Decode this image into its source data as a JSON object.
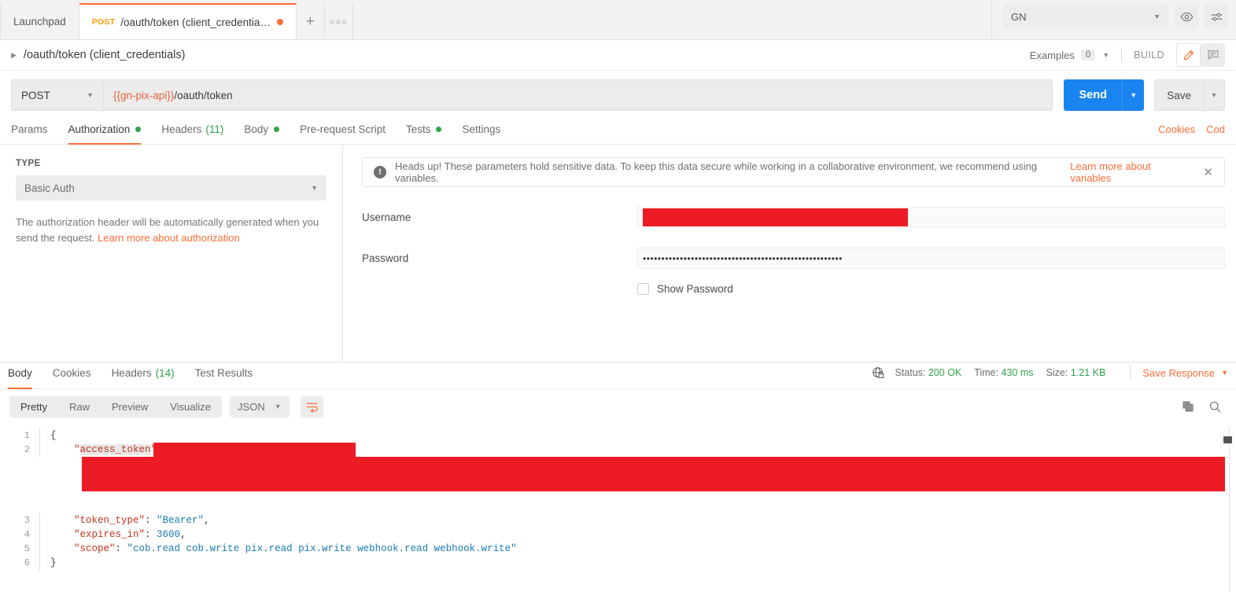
{
  "tabbar": {
    "tabs": [
      {
        "label": "Launchpad",
        "method": "",
        "active": false,
        "unsaved": false
      },
      {
        "label": "/oauth/token (client_credentia…",
        "method": "POST",
        "active": true,
        "unsaved": true
      }
    ],
    "add_tab": "+",
    "more_tabs": "○○○",
    "environment": "GN",
    "caret": "▼",
    "eye_icon": "eye-icon",
    "settings_icon": "sliders-icon"
  },
  "breadcrumb": {
    "expand_arrow": "▶",
    "title": "/oauth/token (client_credentials)",
    "examples_label": "Examples",
    "examples_count": "0",
    "examples_caret": "▼",
    "build_label": "BUILD",
    "edit_icon": "pencil-icon",
    "comment_icon": "comment-icon"
  },
  "url_row": {
    "method": "POST",
    "method_caret": "▼",
    "url_variable": "{{gn-pix-api}}",
    "url_path": "/oauth/token",
    "send_label": "Send",
    "send_caret": "▼",
    "save_label": "Save",
    "save_caret": "▼"
  },
  "request_tabs": {
    "items": [
      {
        "label": "Params",
        "active": false,
        "dot": false,
        "count": ""
      },
      {
        "label": "Authorization",
        "active": true,
        "dot": true,
        "count": ""
      },
      {
        "label": "Headers",
        "active": false,
        "dot": false,
        "count": "(11)"
      },
      {
        "label": "Body",
        "active": false,
        "dot": true,
        "count": ""
      },
      {
        "label": "Pre-request Script",
        "active": false,
        "dot": false,
        "count": ""
      },
      {
        "label": "Tests",
        "active": false,
        "dot": true,
        "count": ""
      },
      {
        "label": "Settings",
        "active": false,
        "dot": false,
        "count": ""
      }
    ],
    "cookies_link": "Cookies",
    "code_link": "Cod"
  },
  "authorization": {
    "type_label": "TYPE",
    "type_value": "Basic Auth",
    "type_caret": "▼",
    "help_text": "The authorization header will be automatically generated when you send the request. ",
    "help_link": "Learn more about authorization",
    "banner_text": "Heads up! These parameters hold sensitive data. To keep this data secure while working in a collaborative environment, we recommend using variables. ",
    "banner_link": "Learn more about variables",
    "banner_icon": "exclamation-icon",
    "banner_close": "✕",
    "username_label": "Username",
    "username_value": "",
    "password_label": "Password",
    "password_value": "••••••••••••••••••••••••••••••••••••••••••••••••••••••",
    "show_password_label": "Show Password"
  },
  "response": {
    "tabs": [
      {
        "label": "Body",
        "active": true,
        "count": ""
      },
      {
        "label": "Cookies",
        "active": false,
        "count": ""
      },
      {
        "label": "Headers",
        "active": false,
        "count": "(14)"
      },
      {
        "label": "Test Results",
        "active": false,
        "count": ""
      }
    ],
    "lock_icon": "globe-lock-icon",
    "status_label": "Status:",
    "status_value": "200 OK",
    "time_label": "Time:",
    "time_value": "430 ms",
    "size_label": "Size:",
    "size_value": "1.21 KB",
    "save_response": "Save Response",
    "save_response_caret": "▼",
    "view_modes": [
      {
        "label": "Pretty",
        "active": true
      },
      {
        "label": "Raw",
        "active": false
      },
      {
        "label": "Preview",
        "active": false
      },
      {
        "label": "Visualize",
        "active": false
      }
    ],
    "format": "JSON",
    "format_caret": "▼",
    "wrap_icon": "word-wrap-icon",
    "copy_icon": "copy-icon",
    "search_icon": "search-icon",
    "body_lines": [
      {
        "no": "1",
        "segments": [
          {
            "t": "{",
            "c": "punc"
          }
        ]
      },
      {
        "no": "2",
        "segments": [
          {
            "t": "    ",
            "c": "punc"
          },
          {
            "t": "\"",
            "c": "key"
          },
          {
            "t": "access_token",
            "c": "key-hl"
          },
          {
            "t": "\"",
            "c": "key"
          },
          {
            "t": ": ",
            "c": "punc"
          },
          {
            "t": "[REDACTED]",
            "c": "redact"
          }
        ]
      },
      {
        "no": "3",
        "segments": [
          {
            "t": "    ",
            "c": "punc"
          },
          {
            "t": "\"token_type\"",
            "c": "key"
          },
          {
            "t": ": ",
            "c": "punc"
          },
          {
            "t": "\"Bearer\"",
            "c": "str"
          },
          {
            "t": ",",
            "c": "punc"
          }
        ]
      },
      {
        "no": "4",
        "segments": [
          {
            "t": "    ",
            "c": "punc"
          },
          {
            "t": "\"expires_in\"",
            "c": "key"
          },
          {
            "t": ": ",
            "c": "punc"
          },
          {
            "t": "3600",
            "c": "num"
          },
          {
            "t": ",",
            "c": "punc"
          }
        ]
      },
      {
        "no": "5",
        "segments": [
          {
            "t": "    ",
            "c": "punc"
          },
          {
            "t": "\"scope\"",
            "c": "key"
          },
          {
            "t": ": ",
            "c": "punc"
          },
          {
            "t": "\"cob.read cob.write pix.read pix.write webhook.read webhook.write\"",
            "c": "str"
          }
        ]
      },
      {
        "no": "6",
        "segments": [
          {
            "t": "}",
            "c": "punc"
          }
        ]
      }
    ]
  },
  "colors": {
    "accent": "#ff6c37",
    "send_blue": "#1a85f0",
    "success_green": "#2fa24a",
    "redaction_red": "#ed1c24",
    "method_orange": "#ff9b00"
  }
}
